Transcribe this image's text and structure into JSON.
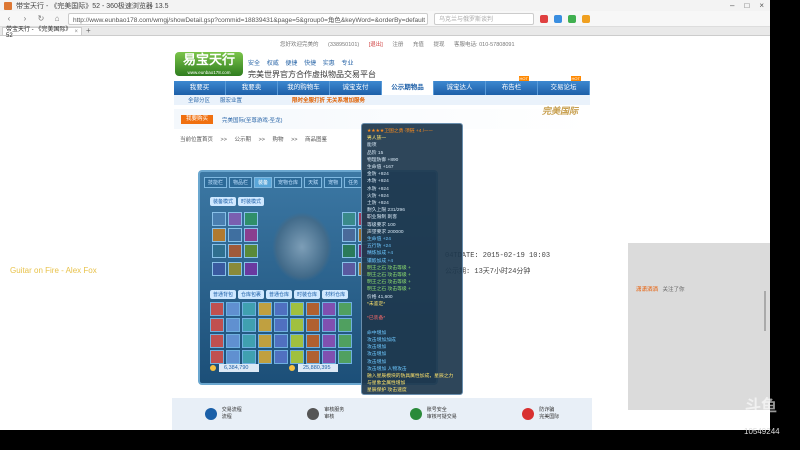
{
  "browser": {
    "title": "带宝天行 - 《完美国际》52 - 360极速浏览器 13.5",
    "url": "http://www.eunbao178.com/wmgj/showDetail.gsp?commid=18839431&page=5&group0=角色&keyWord=&orderBy=default",
    "search_placeholder": "乌克兰与俄罗斯谈判",
    "tab_label": "带宝天行 - 《完美国际》52",
    "tab_close": "×",
    "new_tab": "+",
    "nav_back": "‹",
    "nav_forward": "›",
    "nav_refresh": "↻",
    "nav_home": "⌂",
    "win_min": "–",
    "win_max": "□",
    "win_close": "×"
  },
  "site": {
    "top_strip": [
      "您好欢迎完美的",
      "(338950101)",
      "[退出]",
      "注册",
      "充值",
      "提现",
      "客服电话: 010-57808091"
    ],
    "logo_text": "易宝天行",
    "logo_sub": "www.eunbao178.com",
    "top_links": [
      "安全",
      "权威",
      "便捷",
      "快捷",
      "实惠",
      "专业"
    ],
    "slogan": "完美世界官方合作虚拟物品交易平台",
    "main_nav": [
      {
        "label": "我要买",
        "hot": ""
      },
      {
        "label": "我要卖",
        "hot": ""
      },
      {
        "label": "我的购物车",
        "hot": ""
      },
      {
        "label": "诚宝支付",
        "hot": ""
      },
      {
        "label": "公示期物品",
        "hot": ""
      },
      {
        "label": "诚宝达人",
        "hot": ""
      },
      {
        "label": "布告栏",
        "hot": "HOT"
      },
      {
        "label": "交易论坛",
        "hot": "HOT"
      }
    ],
    "sub_nav": [
      "全部分区",
      "服宏业置"
    ],
    "promo": "限时全服打折 无关系增加服务",
    "banner_button": "我要购买",
    "banner_text": "完美国际(至尊游戏-圣龙)",
    "game_logo": "完美国际",
    "breadcrumb": [
      "当前位置首页",
      ">>",
      "公示期",
      ">>",
      "购物",
      ">>",
      "商品图鉴"
    ]
  },
  "game": {
    "tabs": [
      "技能栏",
      "物品栏",
      "装备",
      "宠物仓库",
      "天赋",
      "宠物",
      "任务"
    ],
    "active_tab": 2,
    "equip_buttons": [
      "装备模式",
      "时装模式"
    ],
    "inv_buttons": [
      "普通背包",
      "仓库包裹",
      "普通仓库",
      "时装仓库",
      "材料仓库"
    ],
    "money": [
      "6,384,790",
      "25,880,395"
    ]
  },
  "overlay_text": [
    "04TDATE: 2015-02-19 10:03",
    "公示期: 13天7小时24分钟"
  ],
  "tooltip": {
    "lines": [
      {
        "text": "★★★★卫国之勇·项链 +4 /ㅡㅡ",
        "color": "#ff8c1a"
      },
      {
        "text": "男人族一",
        "color": "#ffe46b"
      },
      {
        "text": "能项",
        "color": "#d8e8f5"
      },
      {
        "text": "品阶 15",
        "color": "#d8e8f5"
      },
      {
        "text": "物理防御 +890",
        "color": "#d8e8f5"
      },
      {
        "text": "生命值 +167",
        "color": "#d8e8f5"
      },
      {
        "text": "金防 +924",
        "color": "#d8e8f5"
      },
      {
        "text": "木防 +924",
        "color": "#d8e8f5"
      },
      {
        "text": "水防 +924",
        "color": "#d8e8f5"
      },
      {
        "text": "火防 +924",
        "color": "#d8e8f5"
      },
      {
        "text": "土防 +924",
        "color": "#d8e8f5"
      },
      {
        "text": "耐久上限 231/296",
        "color": "#d8e8f5"
      },
      {
        "text": "职业限制 刺客",
        "color": "#d8e8f5"
      },
      {
        "text": "等级要求 100",
        "color": "#d8e8f5"
      },
      {
        "text": "声望要求 200000",
        "color": "#d8e8f5"
      },
      {
        "text": "生命值 +24",
        "color": "#6ec8ff"
      },
      {
        "text": "五行防 +24",
        "color": "#6ec8ff"
      },
      {
        "text": "精炼加成 +4",
        "color": "#6ec8ff"
      },
      {
        "text": "镶嵌加成 +4",
        "color": "#6ec8ff"
      },
      {
        "text": "明王之石 攻击等级 +",
        "color": "#8fe070"
      },
      {
        "text": "明王之石 攻击等级 +",
        "color": "#8fe070"
      },
      {
        "text": "明王之石 攻击等级 +",
        "color": "#8fe070"
      },
      {
        "text": "明王之石 攻击等级 +",
        "color": "#8fe070"
      },
      {
        "text": "价格 41,600",
        "color": "#d8e8f5"
      },
      {
        "text": "*未鉴定*",
        "color": "#ffe46b"
      },
      {
        "text": "",
        "color": "#d8e8f5"
      },
      {
        "text": "*已装备*",
        "color": "#ff6a6a"
      },
      {
        "text": "",
        "color": "#d8e8f5"
      },
      {
        "text": "命中增加",
        "color": "#6ec8ff"
      },
      {
        "text": "攻击增加加成",
        "color": "#6ec8ff"
      },
      {
        "text": "攻击增加",
        "color": "#6ec8ff"
      },
      {
        "text": "攻击增加",
        "color": "#6ec8ff"
      },
      {
        "text": "攻击增加",
        "color": "#6ec8ff"
      },
      {
        "text": "攻击增加 人物攻击",
        "color": "#6ec8ff"
      },
      {
        "text": "融入星辰模块的防具属性加成，星辰之力",
        "color": "#ffe46b"
      },
      {
        "text": "与星象全属性增加",
        "color": "#ffe46b"
      },
      {
        "text": "星辰保护 攻击速度",
        "color": "#ffe46b"
      }
    ]
  },
  "footer": [
    {
      "l1": "交易流程",
      "l2": "流程",
      "color": "#1a5fa8"
    },
    {
      "l1": "审核服务",
      "l2": "审核",
      "color": "#555555"
    },
    {
      "l1": "账号安全",
      "l2": "审核可疑交易",
      "color": "#2a8a3a"
    },
    {
      "l1": "防诈骗",
      "l2": "完美国际",
      "color": "#d83030"
    }
  ],
  "chat": {
    "user": "潇潇洒洒",
    "message": "关注了你"
  },
  "song": "Guitar on Fire - Alex Fox",
  "room_id": "10549244"
}
